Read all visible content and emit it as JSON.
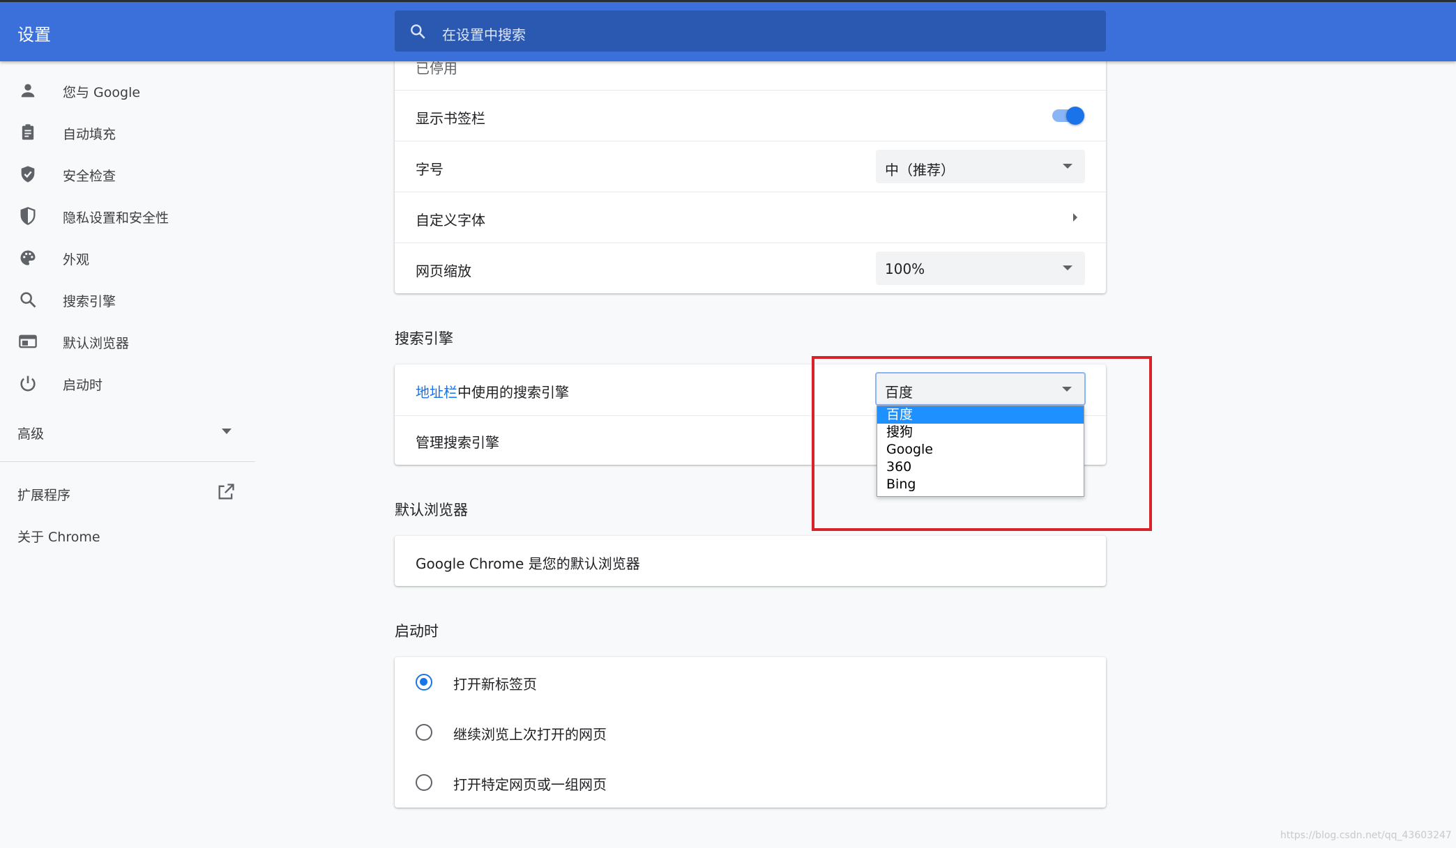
{
  "header": {
    "title": "设置",
    "search_placeholder": "在设置中搜索"
  },
  "sidebar": {
    "items": [
      {
        "label": "您与 Google",
        "icon": "person-icon"
      },
      {
        "label": "自动填充",
        "icon": "clipboard-icon"
      },
      {
        "label": "安全检查",
        "icon": "shield-check-icon"
      },
      {
        "label": "隐私设置和安全性",
        "icon": "shield-half-icon"
      },
      {
        "label": "外观",
        "icon": "palette-icon"
      },
      {
        "label": "搜索引擎",
        "icon": "search-icon"
      },
      {
        "label": "默认浏览器",
        "icon": "browser-icon"
      },
      {
        "label": "启动时",
        "icon": "power-icon"
      }
    ],
    "advanced_label": "高级",
    "extensions_label": "扩展程序",
    "about_label": "关于 Chrome"
  },
  "appearance": {
    "partial_label": "已停用",
    "bookmarks_bar_label": "显示书签栏",
    "bookmarks_bar_on": true,
    "font_size_label": "字号",
    "font_size_value": "中（推荐）",
    "custom_fonts_label": "自定义字体",
    "page_zoom_label": "网页缩放",
    "page_zoom_value": "100%"
  },
  "search_engine": {
    "section_title": "搜索引擎",
    "address_bar_link": "地址栏",
    "address_bar_rest": "中使用的搜索引擎",
    "selected": "百度",
    "options": [
      "百度",
      "搜狗",
      "Google",
      "360",
      "Bing"
    ],
    "manage_label": "管理搜索引擎"
  },
  "default_browser": {
    "section_title": "默认浏览器",
    "status": "Google Chrome 是您的默认浏览器"
  },
  "startup": {
    "section_title": "启动时",
    "options": [
      {
        "label": "打开新标签页",
        "selected": true
      },
      {
        "label": "继续浏览上次打开的网页",
        "selected": false
      },
      {
        "label": "打开特定网页或一组网页",
        "selected": false
      }
    ]
  },
  "watermark": "https://blog.csdn.net/qq_43603247",
  "colors": {
    "header_blue": "#3b6fd9",
    "accent": "#1a73e8",
    "highlight": "#d9232b"
  }
}
